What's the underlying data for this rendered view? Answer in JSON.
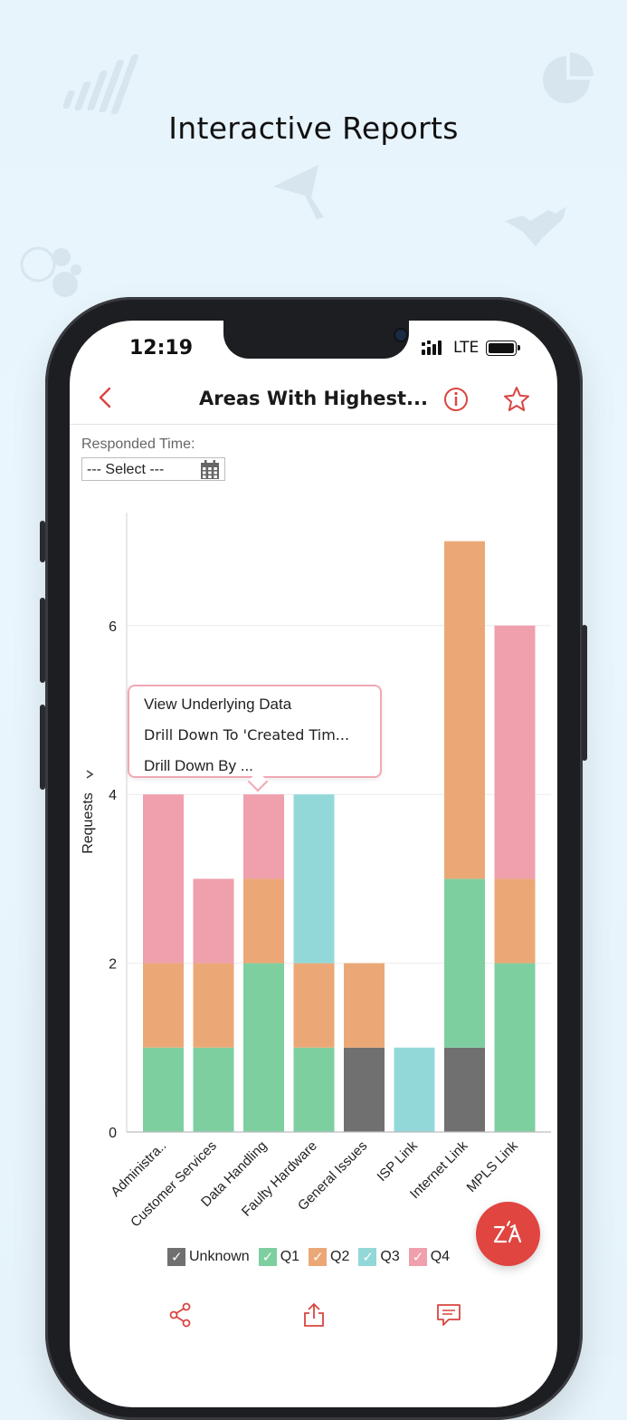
{
  "headline": "Interactive Reports",
  "status_bar": {
    "time": "12:19",
    "network": "LTE"
  },
  "navbar": {
    "title": "Areas With Highest...",
    "back_icon": "chevron-left-icon",
    "info_icon": "info-icon",
    "star_icon": "star-icon"
  },
  "filter": {
    "label": "Responded Time:",
    "value": "--- Select ---",
    "icon": "calendar-icon"
  },
  "popup": {
    "items": [
      "View Underlying Data",
      "Drill Down To 'Created Tim...",
      "Drill Down By ..."
    ]
  },
  "colors": {
    "accent": "#d94540",
    "unknown": "#707070",
    "q1": "#7dcfa0",
    "q2": "#eba876",
    "q3": "#93d8d8",
    "q4": "#f09fac"
  },
  "chart_data": {
    "type": "bar",
    "stacked": true,
    "categories": [
      "Administra..",
      "Customer Services",
      "Data Handling",
      "Faulty Hardware",
      "General Issues",
      "ISP Link",
      "Internet Link",
      "MPLS Link"
    ],
    "series": [
      {
        "name": "Unknown",
        "values": [
          0,
          0,
          0,
          0,
          1,
          0,
          1,
          0
        ]
      },
      {
        "name": "Q1",
        "values": [
          1,
          1,
          2,
          1,
          0,
          0,
          2,
          2
        ]
      },
      {
        "name": "Q2",
        "values": [
          1,
          1,
          1,
          1,
          1,
          0,
          4,
          1
        ]
      },
      {
        "name": "Q3",
        "values": [
          0,
          0,
          0,
          2,
          0,
          1,
          0,
          0
        ]
      },
      {
        "name": "Q4",
        "values": [
          2,
          1,
          1,
          0,
          0,
          0,
          0,
          3
        ]
      }
    ],
    "ylabel": "Requests",
    "ylabel_icon": "chevron-right-icon",
    "yticks": [
      0,
      2,
      4,
      6
    ],
    "ylim": [
      0,
      7
    ],
    "grid": true,
    "legend_position": "bottom"
  },
  "fab": {
    "icon": "zia-assistant-icon"
  },
  "tabbar": {
    "items": [
      "share-icon",
      "export-icon",
      "comment-icon"
    ]
  }
}
